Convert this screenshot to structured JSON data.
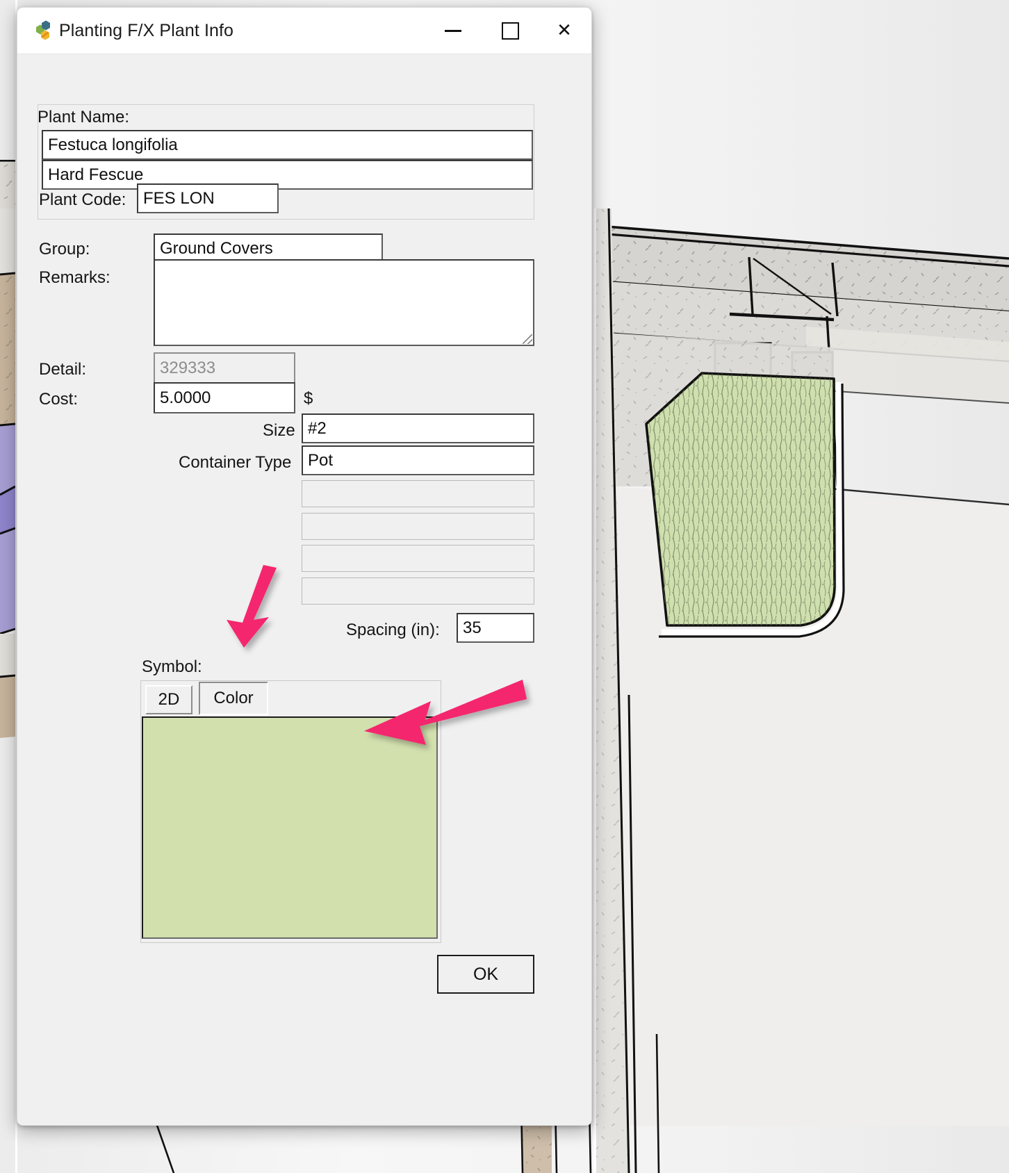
{
  "window": {
    "title": "Planting F/X Plant Info",
    "icon": "planting-fx-logo-icon",
    "minimize_label": "–",
    "maximize_label": "□",
    "close_label": "✕"
  },
  "form": {
    "plant_name_label": "Plant Name:",
    "botanical_name": "Festuca longifolia",
    "common_name": "Hard Fescue",
    "plant_code_label": "Plant Code:",
    "plant_code": "FES LON",
    "group_label": "Group:",
    "group": "Ground Covers",
    "remarks_label": "Remarks:",
    "remarks": "",
    "detail_label": "Detail:",
    "detail": "329333",
    "cost_label": "Cost:",
    "cost": "5.0000",
    "currency_symbol": "$",
    "size_label": "Size",
    "size": "#2",
    "container_type_label": "Container Type",
    "container_type": "Pot",
    "extra_field_1": "",
    "extra_field_2": "",
    "extra_field_3": "",
    "extra_field_4": "",
    "spacing_label": "Spacing (in):",
    "spacing": "35"
  },
  "symbol": {
    "section_label": "Symbol:",
    "tabs": [
      {
        "label": "2D",
        "selected": false
      },
      {
        "label": "Color",
        "selected": true
      }
    ],
    "swatch_color": "#d2e0ae"
  },
  "buttons": {
    "ok_label": "OK"
  },
  "annotations": {
    "arrow_color": "#f4266e",
    "arrow_1_target": "color-tab",
    "arrow_2_target": "color-swatch-preview"
  },
  "colors": {
    "dialog_bg": "#f0f0f0",
    "titlebar_bg": "#ffffff",
    "field_bg": "#ffffff",
    "field_border": "#4a4a4a",
    "disabled_text": "#8a8a8a",
    "swatch_green": "#d2e0ae",
    "drawing_green": "#cfdfae",
    "drawing_grey": "#d6d4d0",
    "drawing_tan": "#c7b49c",
    "drawing_purple": "#a79ed4",
    "accent_pink": "#f4266e"
  }
}
